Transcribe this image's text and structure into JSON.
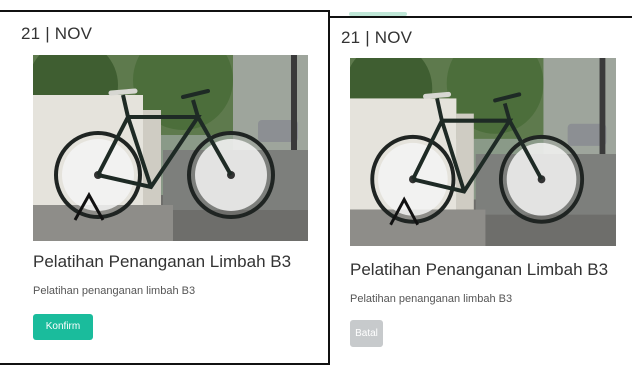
{
  "cards": [
    {
      "date": "21 | NOV",
      "image_alt": "bicycle",
      "title": "Pelatihan Penanganan Limbah B3",
      "description": "Pelatihan penanganan limbah B3",
      "button_label": "Konfirm",
      "button_color": "#1abc9c"
    },
    {
      "date": "21 | NOV",
      "image_alt": "bicycle",
      "title": "Pelatihan Penanganan Limbah B3",
      "description": "Pelatihan penanganan limbah B3",
      "button_label": "Batal",
      "button_color": "#c7cacc"
    }
  ],
  "colors": {
    "border": "#111111",
    "text": "#333333",
    "accent": "#1abc9c"
  }
}
